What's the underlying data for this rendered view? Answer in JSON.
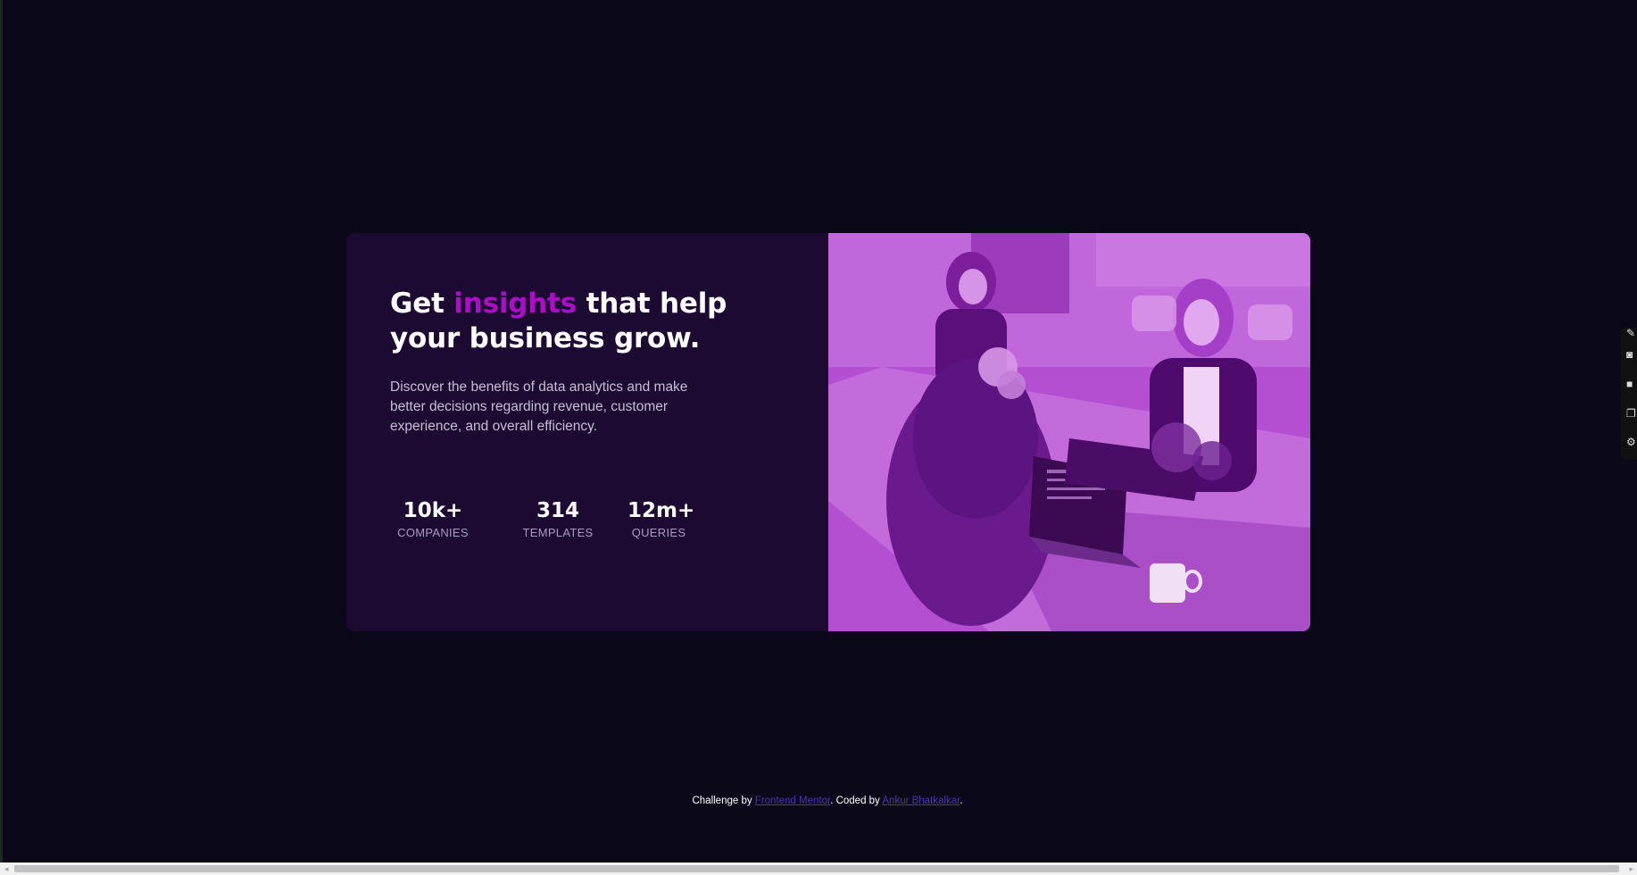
{
  "hero": {
    "headline_pre": "Get ",
    "headline_accent": "insights",
    "headline_post": " that help your business grow.",
    "description": "Discover the benefits of data analytics and make better decisions regarding revenue, customer experience, and overall efficiency.",
    "stats": [
      {
        "value": "10k+",
        "label": "COMPANIES"
      },
      {
        "value": "314",
        "label": "TEMPLATES"
      },
      {
        "value": "12m+",
        "label": "QUERIES"
      }
    ]
  },
  "footer": {
    "prefix": "Challenge by ",
    "link1": "Frontend Mentor",
    "middle": ". Coded by ",
    "link2": "Ankur Bhatkalkar",
    "suffix": "."
  },
  "colors": {
    "background": "#0b0819",
    "card": "#1c0a33",
    "accent": "#aa0fc6",
    "image_tint": "#b24fd1",
    "link": "#4c35b5"
  },
  "icons": {
    "toolbar": [
      "pin-icon",
      "camera-icon",
      "square-icon",
      "copy-icon",
      "gear-icon"
    ]
  }
}
